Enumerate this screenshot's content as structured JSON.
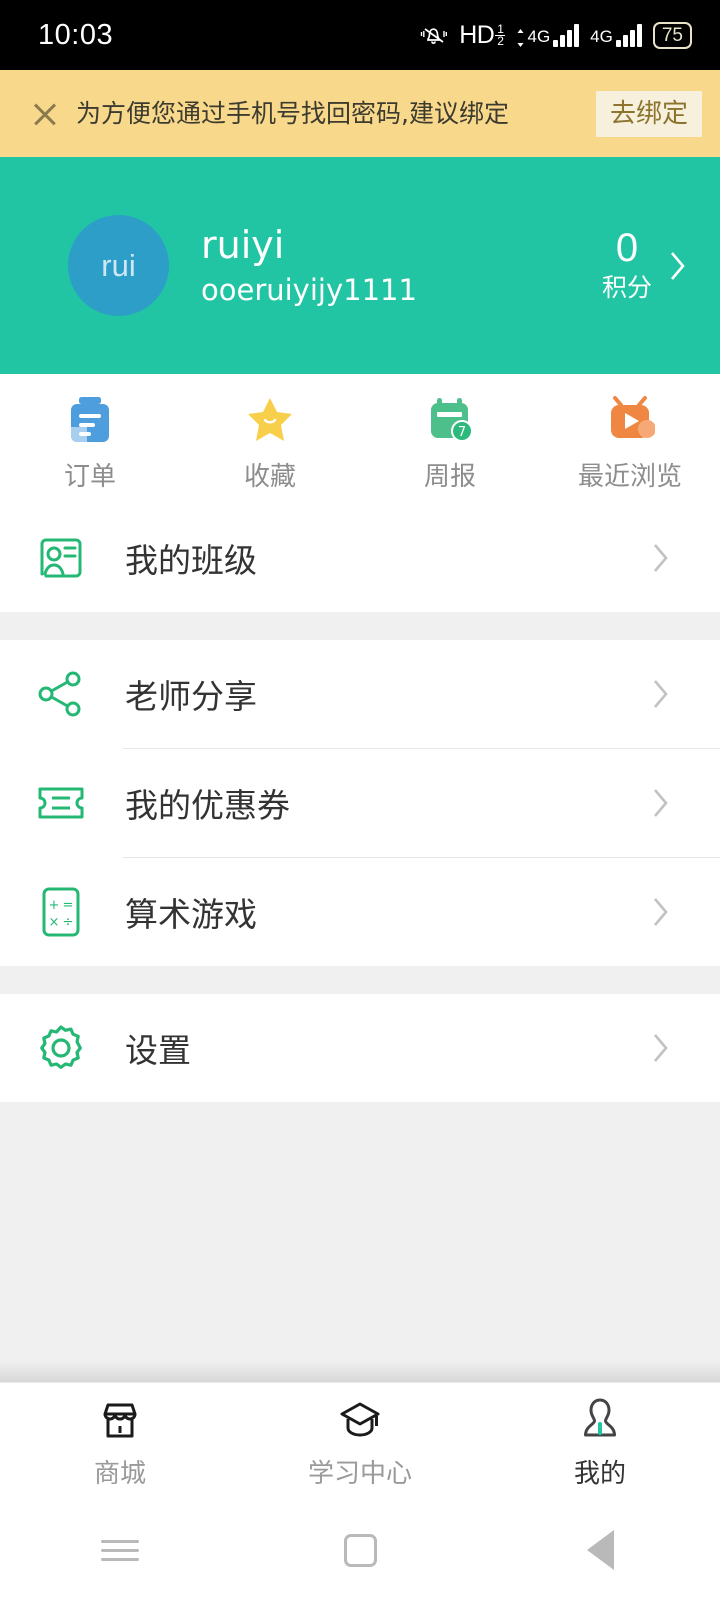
{
  "statusbar": {
    "time": "10:03",
    "hd_label": "HD",
    "hd_num": "1",
    "hd_den": "2",
    "net1": "4G",
    "net2": "4G",
    "battery": "75",
    "icons": [
      "silent-bell-icon",
      "hd-voice-icon",
      "signal-4g-icon",
      "signal-4g-icon",
      "battery-icon"
    ]
  },
  "banner": {
    "close_icon": "close-icon",
    "message": "为方便您通过手机号找回密码,建议绑定",
    "button_label": "去绑定",
    "background": "#f8d98c",
    "button_background": "#f6f0dd",
    "button_text_color": "#8c742f"
  },
  "profile": {
    "background": "#21c5a4",
    "avatar_text": "rui",
    "avatar_background": "#2c9ec7",
    "username": "ruiyi",
    "account": "ooeruiyijy1111",
    "points_value": "0",
    "points_label": "积分",
    "chevron_icon": "chevron-right-icon"
  },
  "quick_actions": [
    {
      "label": "订单",
      "icon": "order-clipboard-icon",
      "color": "#4e9ede"
    },
    {
      "label": "收藏",
      "icon": "star-icon",
      "color": "#f8cf4b"
    },
    {
      "label": "周报",
      "icon": "calendar-week-icon",
      "color": "#4cbf8b"
    },
    {
      "label": "最近浏览",
      "icon": "tv-play-icon",
      "color": "#ef8743"
    }
  ],
  "menu_groups": [
    {
      "items": [
        {
          "label": "我的班级",
          "icon": "class-card-icon",
          "chevron": "chevron-right-icon"
        }
      ]
    },
    {
      "items": [
        {
          "label": "老师分享",
          "icon": "share-icon",
          "chevron": "chevron-right-icon"
        },
        {
          "label": "我的优惠券",
          "icon": "coupon-ticket-icon",
          "chevron": "chevron-right-icon"
        },
        {
          "label": "算术游戏",
          "icon": "calculator-icon",
          "chevron": "chevron-right-icon"
        }
      ]
    },
    {
      "items": [
        {
          "label": "设置",
          "icon": "gear-icon",
          "chevron": "chevron-right-icon"
        }
      ]
    }
  ],
  "tabbar": {
    "accent": "#21c5a4",
    "tabs": [
      {
        "label": "商城",
        "icon": "store-icon",
        "active": false
      },
      {
        "label": "学习中心",
        "icon": "graduation-cap-icon",
        "active": false
      },
      {
        "label": "我的",
        "icon": "person-icon",
        "active": true
      }
    ]
  },
  "navbar": {
    "recents": "menu-lines-icon",
    "home": "home-square-icon",
    "back": "back-triangle-icon"
  }
}
